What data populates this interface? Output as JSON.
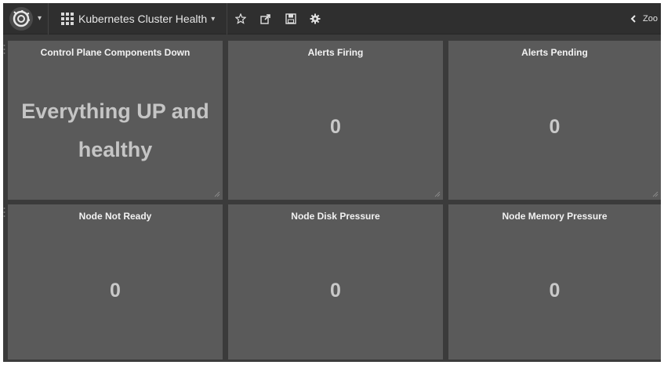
{
  "navbar": {
    "dashboard_title": "Kubernetes Cluster Health",
    "zoom_label": "Zoo",
    "icons": [
      "grafana-logo-icon",
      "dashboard-grid-icon",
      "star-icon",
      "share-icon",
      "save-icon",
      "gear-icon",
      "chevron-left-icon"
    ]
  },
  "panels": [
    {
      "title": "Control Plane Components Down",
      "text_line1": "Everything UP and",
      "text_line2": "healthy"
    },
    {
      "title": "Alerts Firing",
      "value": "0"
    },
    {
      "title": "Alerts Pending",
      "value": "0"
    },
    {
      "title": "Node Not Ready",
      "value": "0"
    },
    {
      "title": "Node Disk Pressure",
      "value": "0"
    },
    {
      "title": "Node Memory Pressure",
      "value": "0"
    }
  ],
  "colors": {
    "background": "#3b3b3b",
    "navbar": "#2f2f2f",
    "panel": "#5a5a5a",
    "value_text": "#c9c9c9"
  }
}
